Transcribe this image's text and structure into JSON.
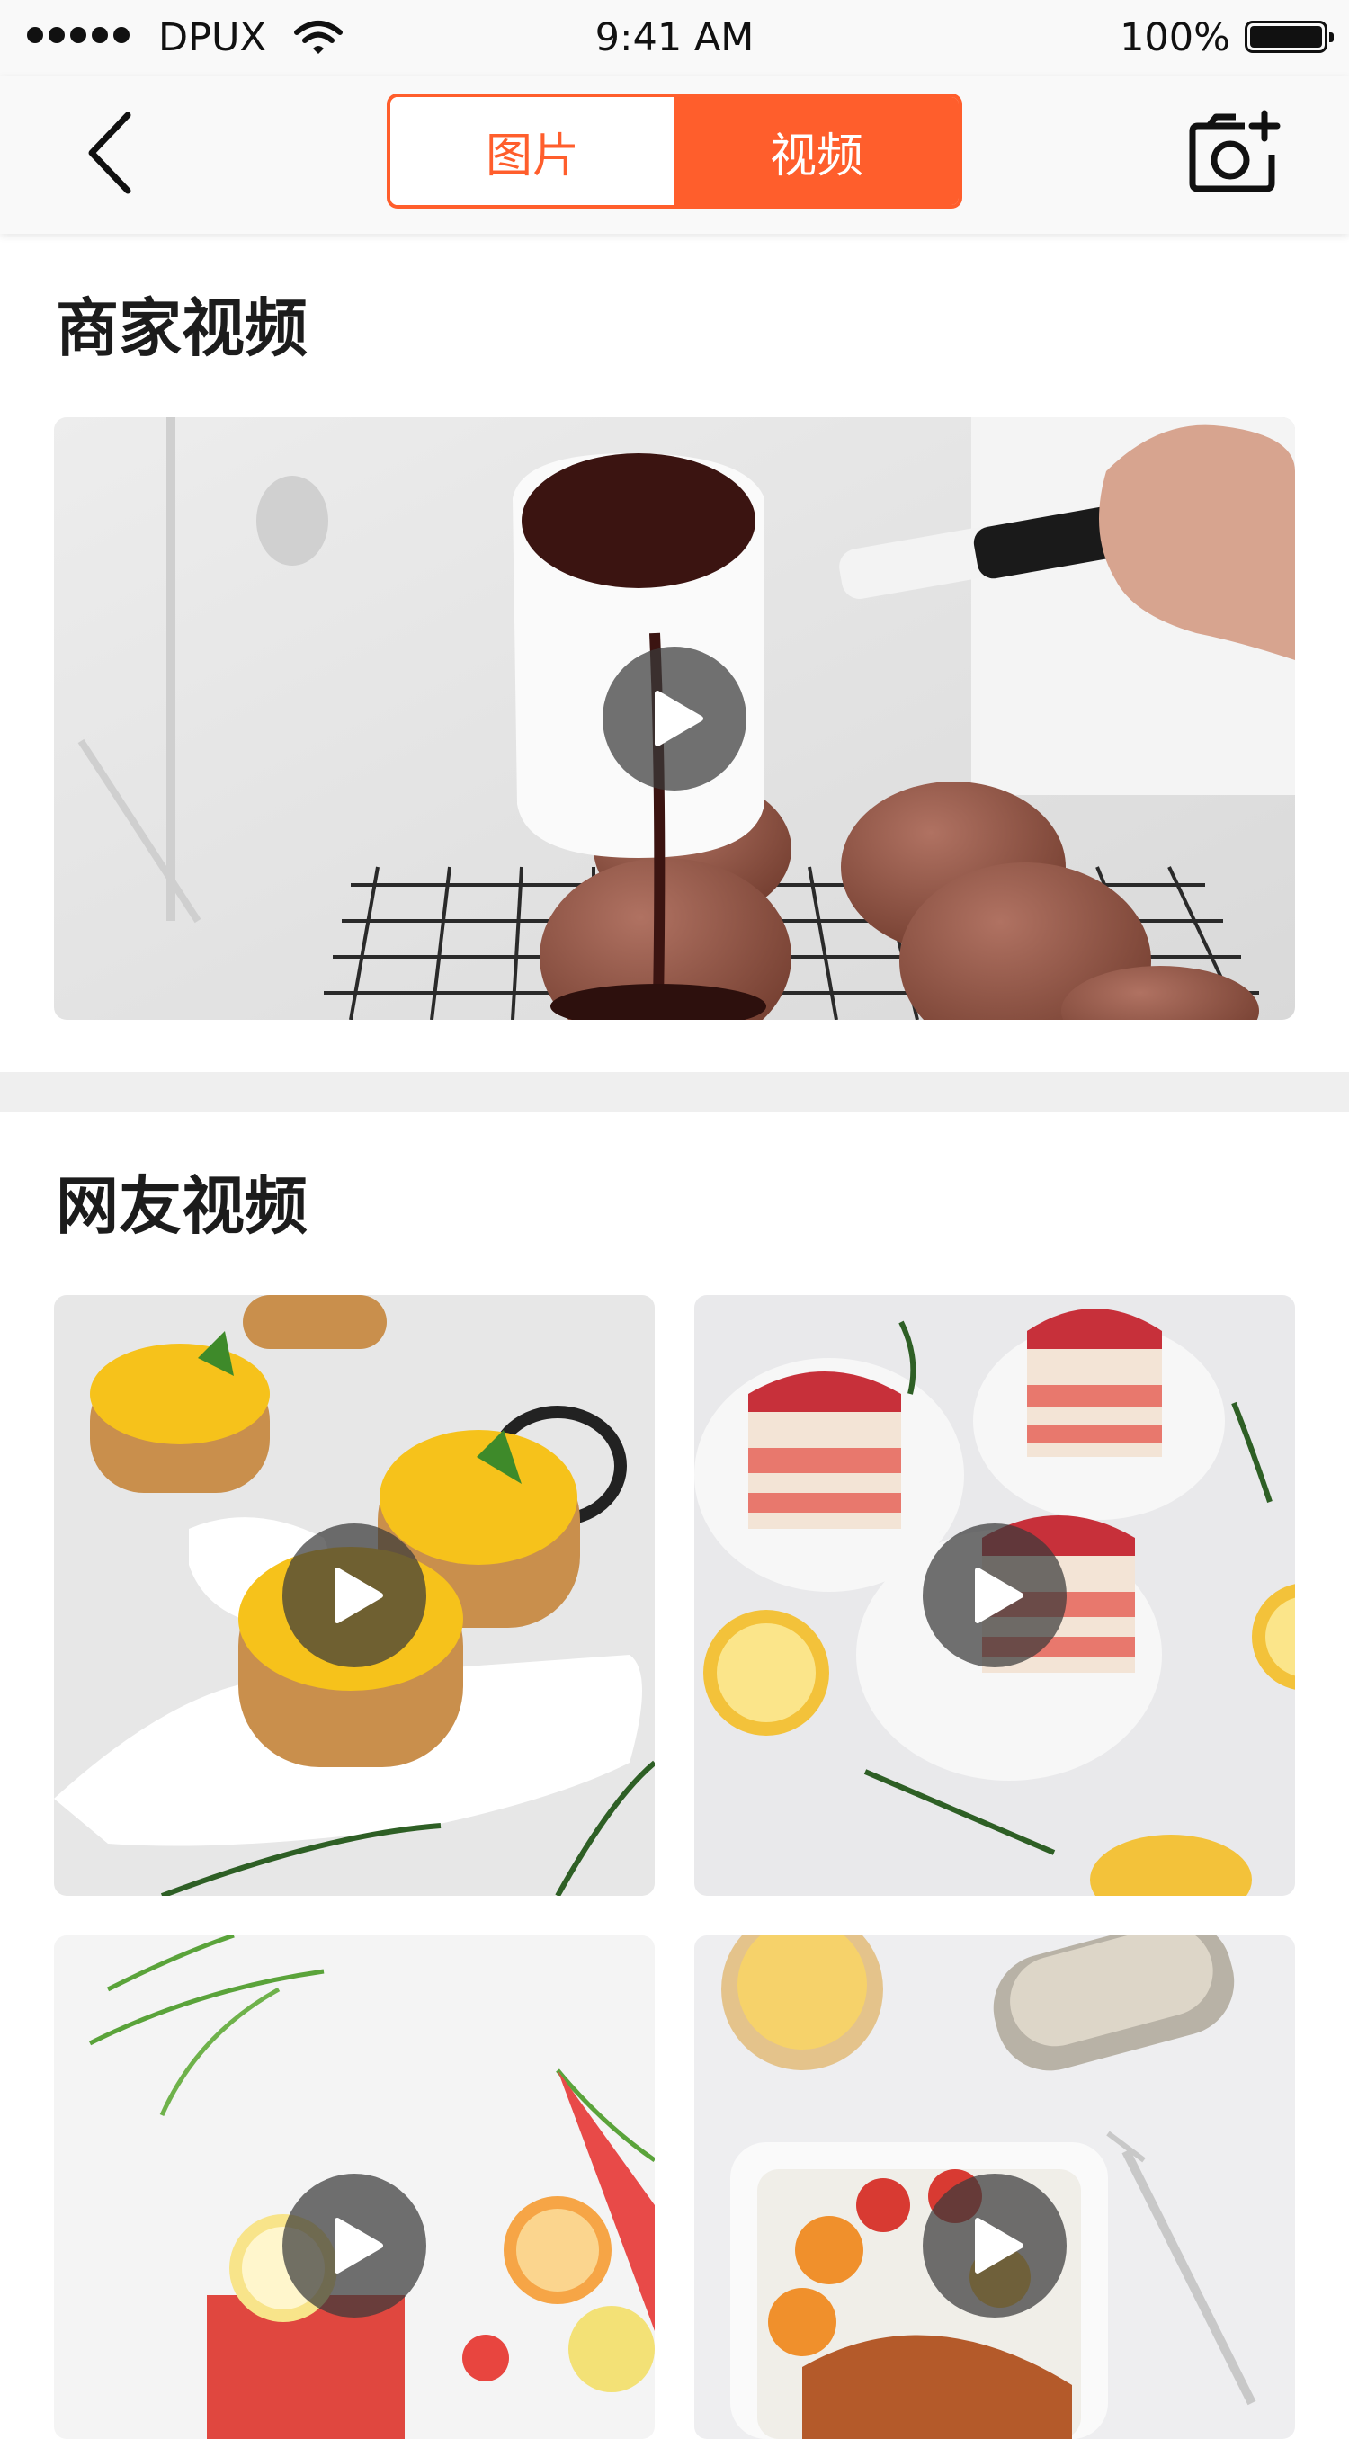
{
  "status_bar": {
    "carrier": "DPUX",
    "time": "9:41 AM",
    "battery_percent": "100%",
    "signal_icon": "signal-dots-icon",
    "wifi_icon": "wifi-icon",
    "battery_icon": "battery-full-icon",
    "battery_level": 1.0
  },
  "nav": {
    "back_icon": "chevron-left-icon",
    "tabs": [
      {
        "label": "图片",
        "active": false
      },
      {
        "label": "视频",
        "active": true
      }
    ],
    "camera_icon": "camera-add-icon"
  },
  "sections": {
    "merchant": {
      "title": "商家视频"
    },
    "user": {
      "title": "网友视频"
    }
  },
  "videos": {
    "featured": {
      "thumbnail_subject": "chocolate sauce poured over domed cakes"
    },
    "grid": [
      {
        "thumbnail_subject": "lemon tarts"
      },
      {
        "thumbnail_subject": "strawberry layer cakes"
      },
      {
        "thumbnail_subject": "watermelon lemon drink"
      },
      {
        "thumbnail_subject": "roasted dish with tomatoes and lemon"
      }
    ]
  },
  "theme": {
    "accent": "#ff5e2c",
    "nav_background": "#f9f9f9",
    "divider": "#efefef",
    "play_overlay": "#3a3a3a"
  }
}
